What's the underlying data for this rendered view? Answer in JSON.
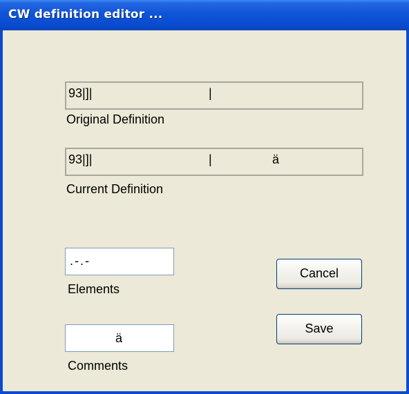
{
  "window": {
    "title": "CW definition editor ..."
  },
  "original_definition": {
    "seg1": "93|]|",
    "seg2": "|",
    "label": "Original Definition"
  },
  "current_definition": {
    "seg1": "93|]|",
    "seg2": "|",
    "seg3": "ä",
    "label": "Current Definition"
  },
  "elements": {
    "value": ".-.-",
    "label": "Elements"
  },
  "comments": {
    "value": "ä",
    "label": "Comments"
  },
  "buttons": {
    "cancel_label": "Cancel",
    "save_label": "Save"
  },
  "colors": {
    "title_bar": "#0a4cd0",
    "dialog_background": "#ece9d8",
    "title_text": "#ffffff"
  }
}
